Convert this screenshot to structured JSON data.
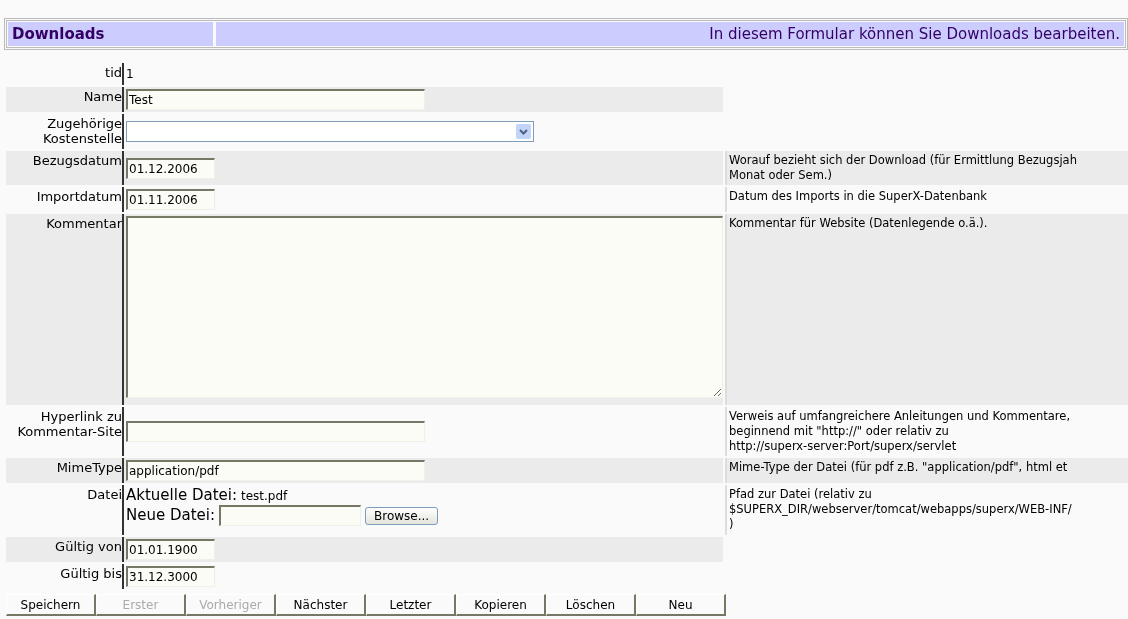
{
  "header": {
    "title": "Downloads",
    "subtitle": "In diesem Formular können Sie Downloads bearbeiten."
  },
  "fields": [
    {
      "label": "tid",
      "kind": "text",
      "value": "1"
    },
    {
      "label": "Name",
      "kind": "input",
      "value": "Test"
    },
    {
      "label": "Zugehörige Kostenstelle",
      "kind": "select"
    },
    {
      "label": "Bezugsdatum",
      "kind": "date",
      "value": "01.12.2006",
      "help": [
        "Worauf bezieht sich der Download (für Ermittlung Bezugsjah",
        "Monat oder Sem.)"
      ]
    },
    {
      "label": "Importdatum",
      "kind": "date",
      "value": "01.11.2006",
      "help": [
        "Datum des Imports in die SuperX-Datenbank"
      ]
    },
    {
      "label": "Kommentar",
      "kind": "textarea",
      "help": [
        "Kommentar für Website (Datenlegende o.ä.)."
      ]
    },
    {
      "label": "Hyperlink zu Kommentar-Site",
      "kind": "input",
      "help": [
        "Verweis auf umfangreichere Anleitungen und Kommentare,",
        "beginnend mit \"http://\" oder relativ zu",
        "http://superx-server:Port/superx/servlet"
      ]
    },
    {
      "label": "MimeType",
      "kind": "input",
      "value": "application/pdf",
      "help": [
        "Mime-Type der Datei (für pdf z.B. \"application/pdf\", html et"
      ]
    },
    {
      "label": "Datei",
      "kind": "file",
      "current_label": "Aktuelle Datei:",
      "current_file": "test.pdf",
      "new_label": "Neue Datei:",
      "browse": "Browse...",
      "help": [
        "Pfad zur Datei (relativ zu",
        "$SUPERX_DIR/webserver/tomcat/webapps/superx/WEB-INF/",
        ")"
      ]
    },
    {
      "label": "Gültig von",
      "kind": "date",
      "value": "01.01.1900"
    },
    {
      "label": "Gültig bis",
      "kind": "date",
      "value": "31.12.3000"
    }
  ],
  "buttons": [
    {
      "label": "Speichern",
      "disabled": false
    },
    {
      "label": "Erster",
      "disabled": true
    },
    {
      "label": "Vorheriger",
      "disabled": true
    },
    {
      "label": "Nächster",
      "disabled": false
    },
    {
      "label": "Letzter",
      "disabled": false
    },
    {
      "label": "Kopieren",
      "disabled": false
    },
    {
      "label": "Löschen",
      "disabled": false
    },
    {
      "label": "Neu",
      "disabled": false
    }
  ]
}
